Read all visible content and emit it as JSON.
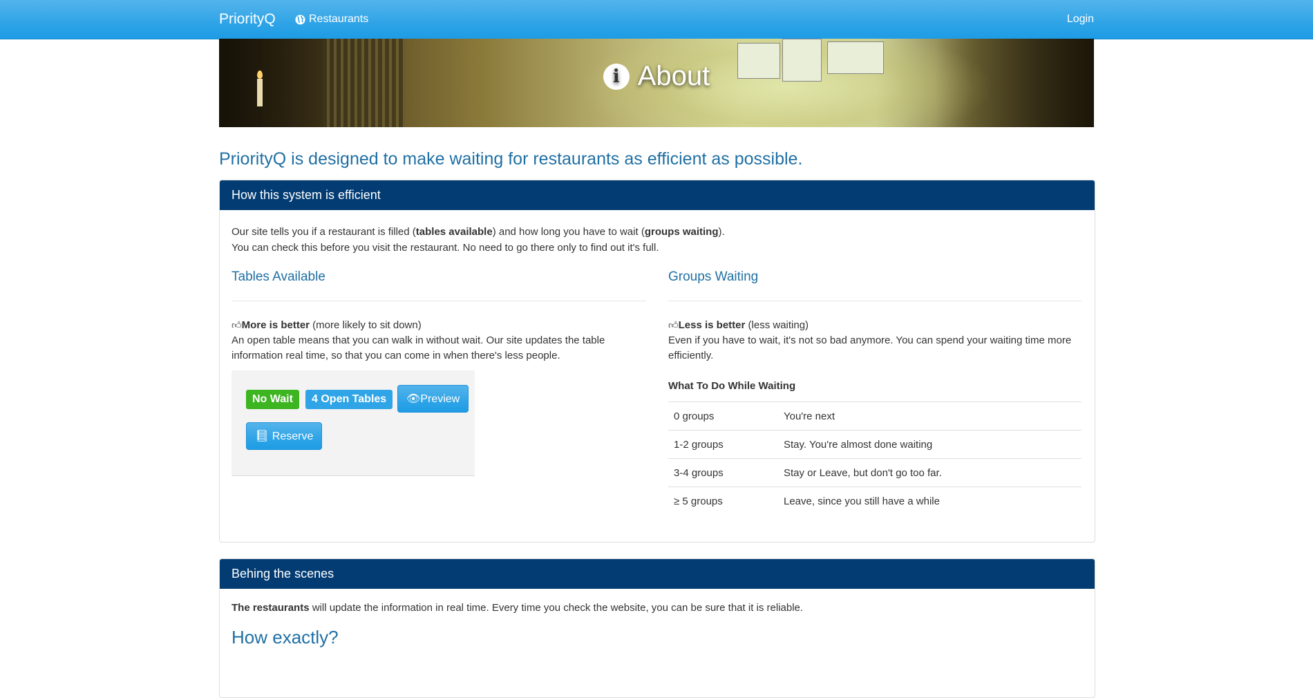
{
  "navbar": {
    "brand": "PriorityQ",
    "restaurants": "Restaurants",
    "login": "Login"
  },
  "hero": {
    "title": "About"
  },
  "lead": "PriorityQ is designed to make waiting for restaurants as efficient as possible.",
  "efficient": {
    "heading": "How this system is efficient",
    "intro_1a": "Our site tells you if a restaurant is filled (",
    "intro_1b": "tables available",
    "intro_1c": ") and how long you have to wait (",
    "intro_1d": "groups waiting",
    "intro_1e": ").",
    "intro_2": "You can check this before you visit the restaurant. No need to go there only to find out it's full.",
    "tables": {
      "title": "Tables Available",
      "bold": "More is better",
      "note": " (more likely to sit down)",
      "text": "An open table means that you can walk in without wait. Our site updates the table information real time, so that you can come in when there's less people.",
      "demo": {
        "no_wait": "No Wait",
        "open_tables": "4 Open Tables",
        "preview": "Preview",
        "reserve": "Reserve"
      }
    },
    "groups": {
      "title": "Groups Waiting",
      "bold": "Less is better",
      "note": " (less waiting)",
      "text": "Even if you have to wait, it's not so bad anymore. You can spend your waiting time more efficiently.",
      "table_title": "What To Do While Waiting",
      "rows": [
        {
          "groups": "0 groups",
          "action": "You're next"
        },
        {
          "groups": "1-2 groups",
          "action": "Stay. You're almost done waiting"
        },
        {
          "groups": "3-4 groups",
          "action": "Stay or Leave, but don't go too far."
        },
        {
          "groups": "≥ 5 groups",
          "action": "Leave, since you still have a while"
        }
      ]
    }
  },
  "behind": {
    "heading": "Behing the scenes",
    "bold": "The restaurants",
    "text": " will update the information in real time. Every time you check the website, you can be sure that it is reliable.",
    "how": "How exactly?"
  },
  "colors": {
    "navbar": "#2fa4e7",
    "panel_heading": "#033c73",
    "success": "#3cb521",
    "primary": "#2fa4e7",
    "accent_text": "#1f6fa3"
  }
}
